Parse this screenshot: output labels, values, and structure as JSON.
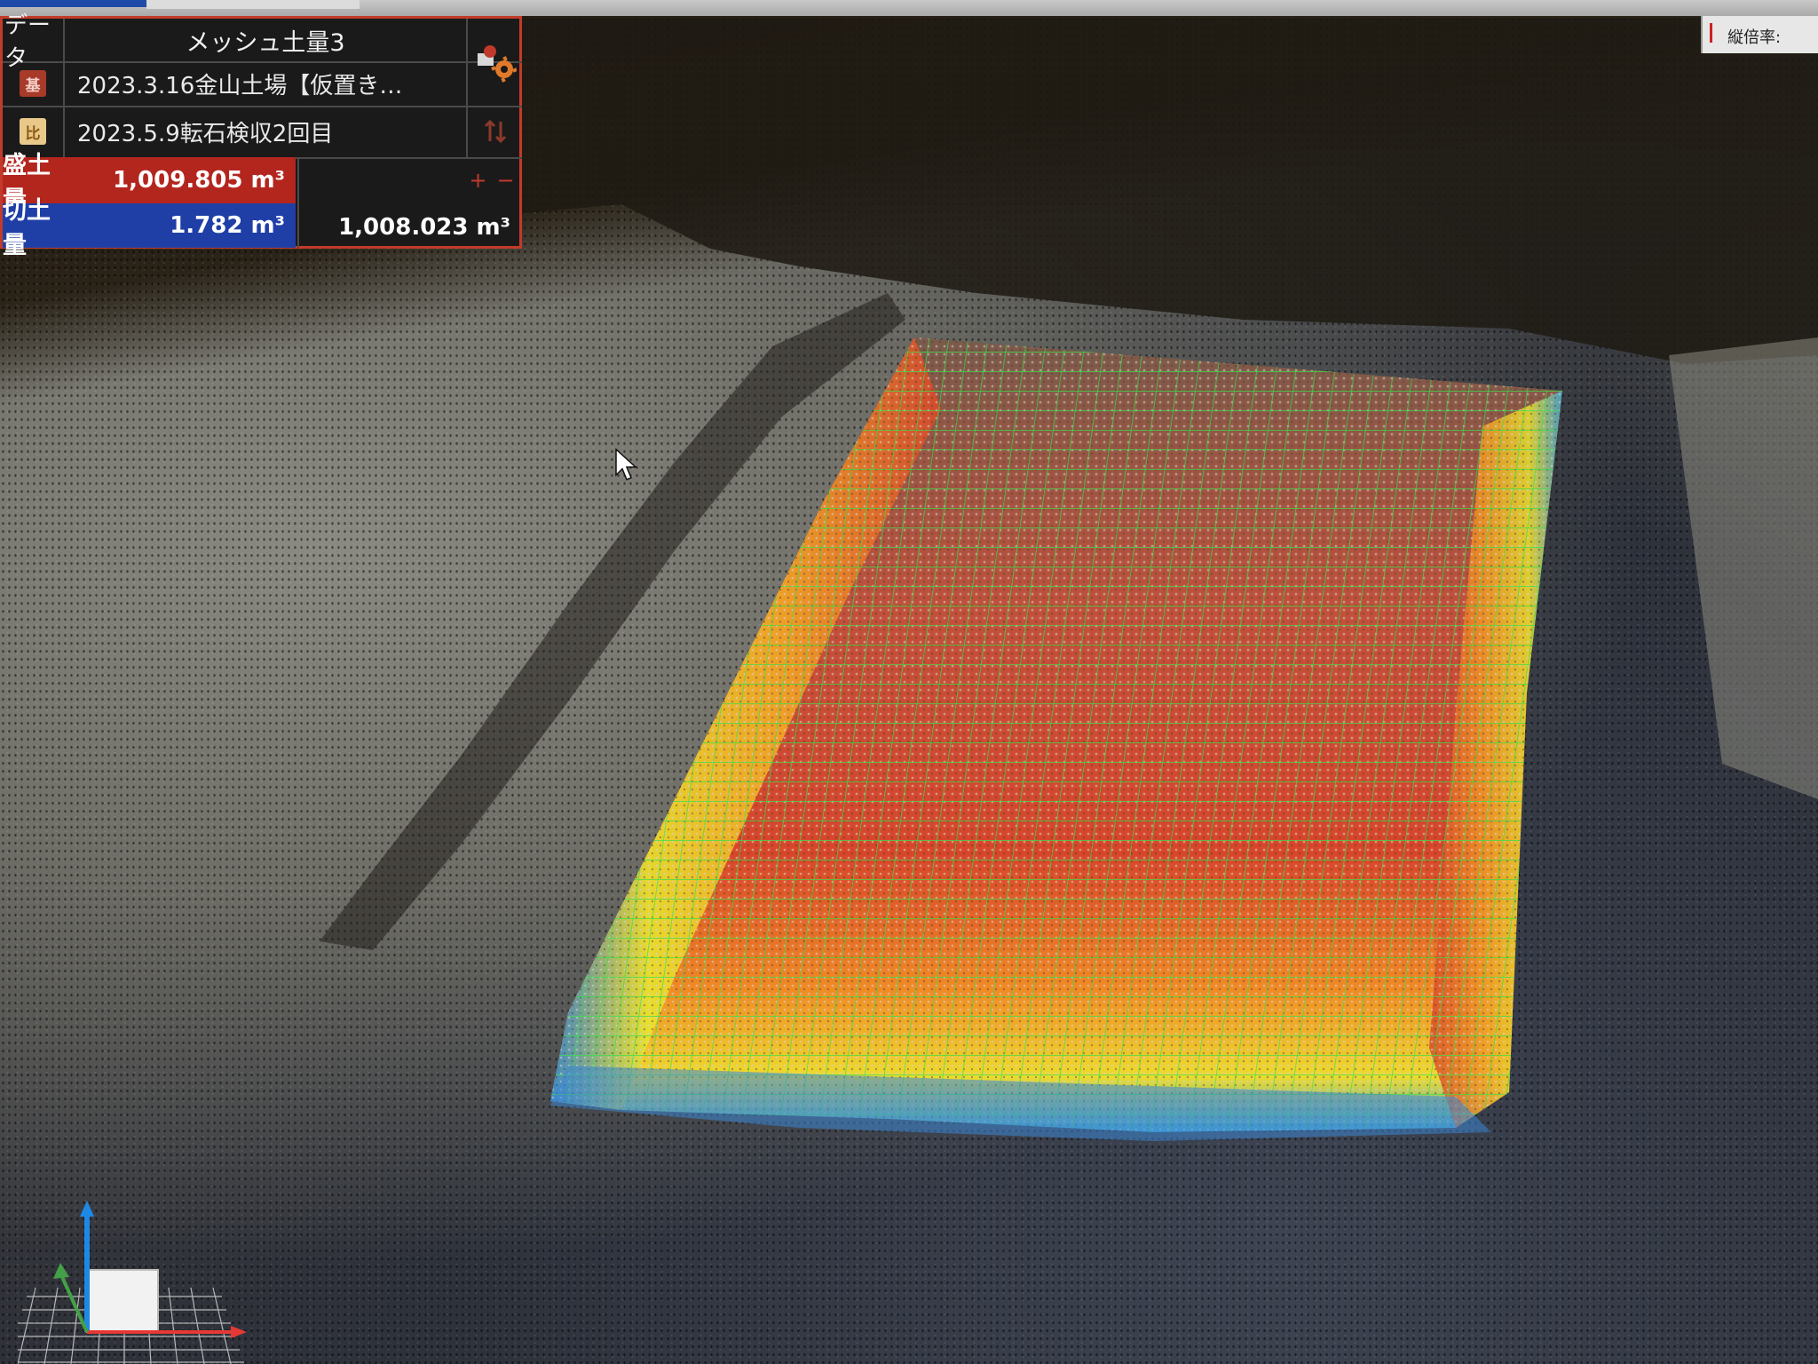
{
  "window": {
    "zoom_label": "縦倍率:"
  },
  "panel": {
    "data_header": "データ",
    "mesh_title": "メッシュ土量3",
    "base": {
      "badge": "基",
      "badge_color": "#c0392b",
      "name": "2023.3.16金山土場【仮置き…"
    },
    "compare": {
      "badge": "比",
      "badge_color": "#d9a441",
      "name": "2023.5.9転石検収2回目"
    },
    "fill": {
      "label": "盛土量",
      "value": "1,009.805 m³",
      "color": "#b3261e"
    },
    "cut": {
      "label": "切土量",
      "value": "1.782 m³",
      "color": "#1f3fa6"
    },
    "difference": {
      "value": "1,008.023 m³"
    },
    "plus_minus": [
      "+",
      "−"
    ],
    "icons": {
      "settings": "gear-icon",
      "swap": "swap-arrows-icon"
    }
  },
  "gizmo": {
    "axes": [
      "x",
      "y",
      "z"
    ],
    "colors": {
      "x": "#e53935",
      "y": "#43a047",
      "z": "#1e88e5"
    }
  },
  "heatmap_colors": [
    "#2e7de0",
    "#3fb8d8",
    "#e6e62a",
    "#f5b021",
    "#f07a1c",
    "#e04418"
  ]
}
